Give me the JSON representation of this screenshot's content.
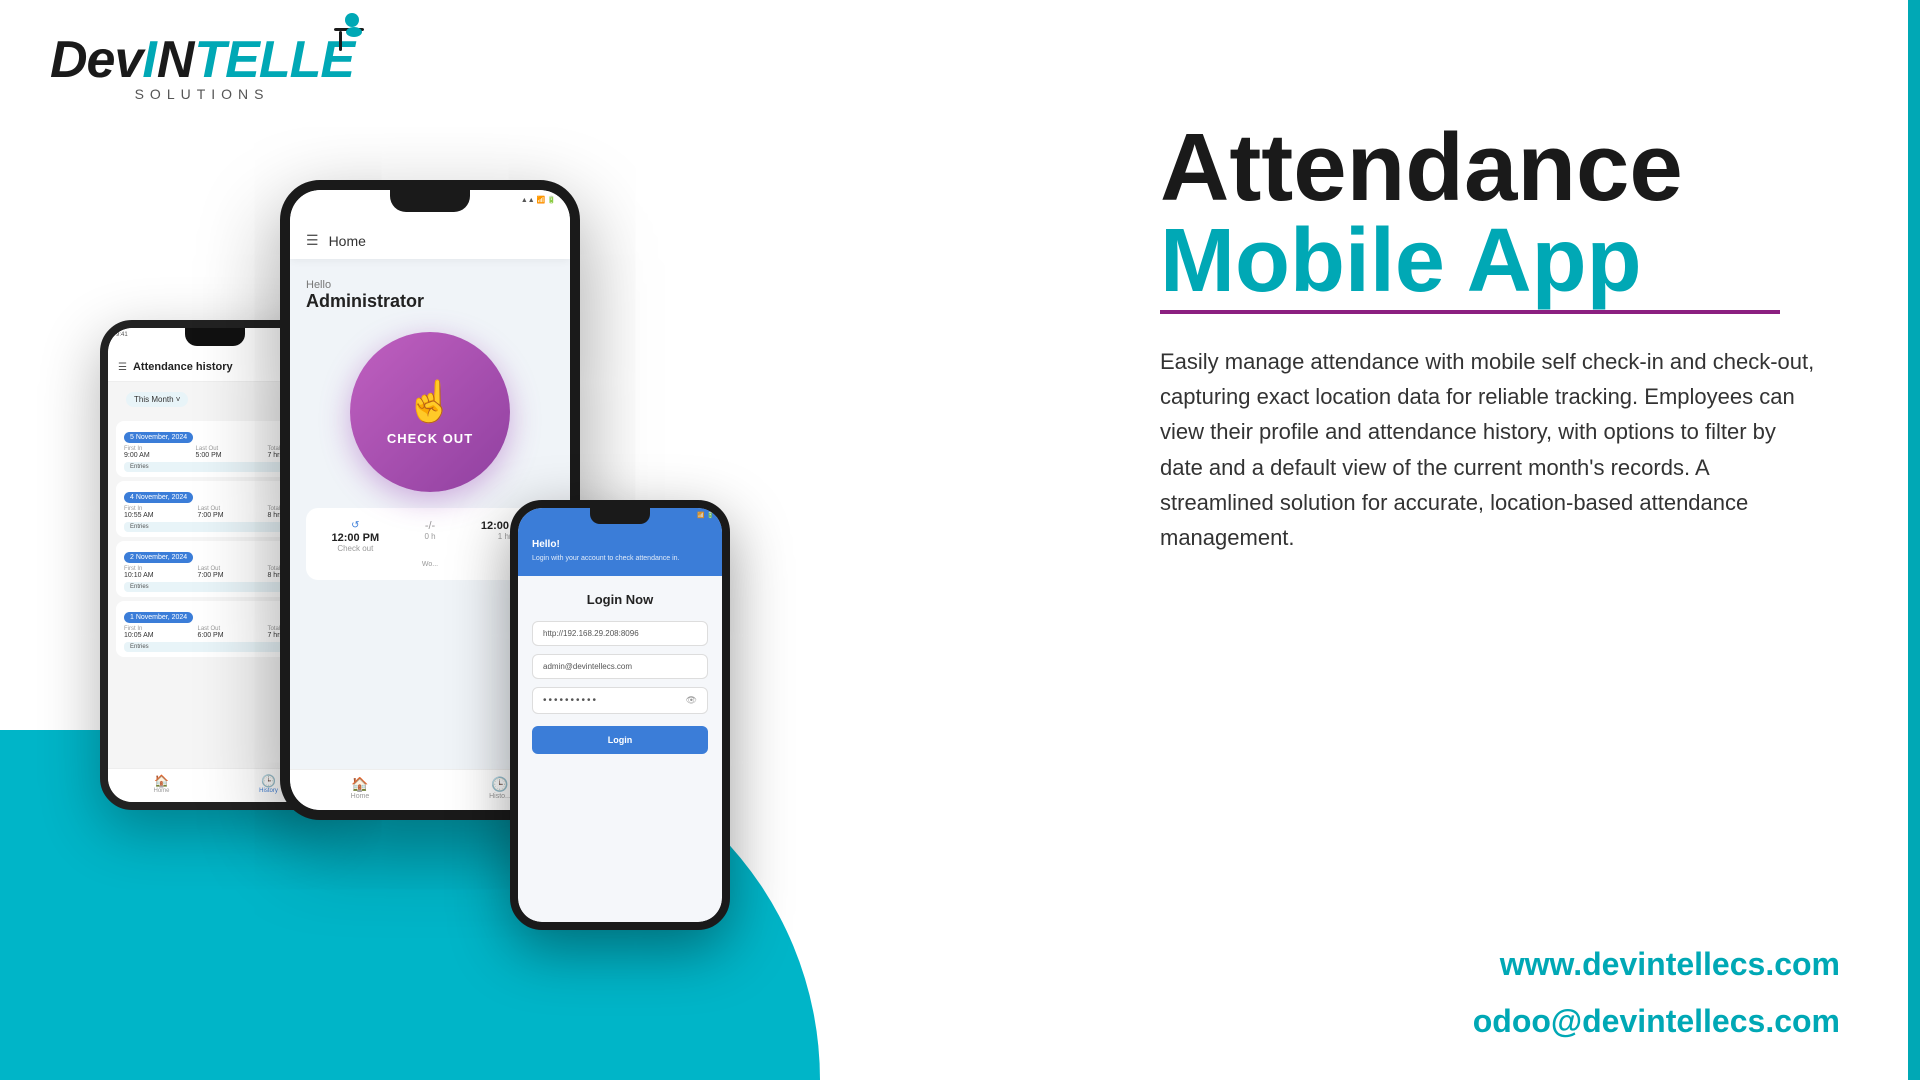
{
  "logo": {
    "dev": "Dev",
    "in": "In",
    "telle": "telle",
    "solutions": "SOLUTIONS"
  },
  "headline": {
    "line1": "Attendance",
    "line2": "Mobile App"
  },
  "description": "Easily manage attendance with mobile self check-in and check-out, capturing exact location data for reliable tracking. Employees can view their profile and attendance history, with options to filter by date and a default view of the current month's records. A streamlined solution for accurate, location-based attendance management.",
  "phone_main": {
    "header": "Home",
    "hello": "Hello",
    "name": "Administrator",
    "checkout_label": "CHECK OUT",
    "time1_label": "12:00 PM",
    "time1_sub": "Check out",
    "divider": "-/-",
    "time2_label": "12:00 PM",
    "worked": "1 hr"
  },
  "phone_history": {
    "title": "Attendance history",
    "filter": "This Month ˅",
    "entries": [
      {
        "date": "5 November, 2024",
        "first_in_label": "First In",
        "first_in": "9:00 AM",
        "last_out_label": "Last Out",
        "last_out": "5:00 PM",
        "total_label": "Total Duration",
        "total": "7 hrs 00 min"
      },
      {
        "date": "4 November, 2024",
        "first_in": "10:55 AM",
        "last_out": "7:00 PM",
        "total": "8 hrs 00 min"
      },
      {
        "date": "2 November, 2024",
        "first_in": "10:10 AM",
        "last_out": "7:00 PM",
        "total": "8 hrs 43 min"
      },
      {
        "date": "1 November, 2024",
        "first_in": "10:05 AM",
        "last_out": "6:00 PM",
        "total": "7 hrs 00 min"
      }
    ],
    "nav_home": "Home",
    "nav_history": "History"
  },
  "phone_login": {
    "hello": "Hello!",
    "sub": "Login with your account to check attendance in.",
    "title": "Login Now",
    "url_placeholder": "http://192.168.29.208:8096",
    "email_placeholder": "admin@devintellecs.com",
    "password": "••••••••••",
    "btn_label": "Login"
  },
  "footer": {
    "website": "www.devintellecs.com",
    "email": "odoo@devintellecs.com"
  }
}
